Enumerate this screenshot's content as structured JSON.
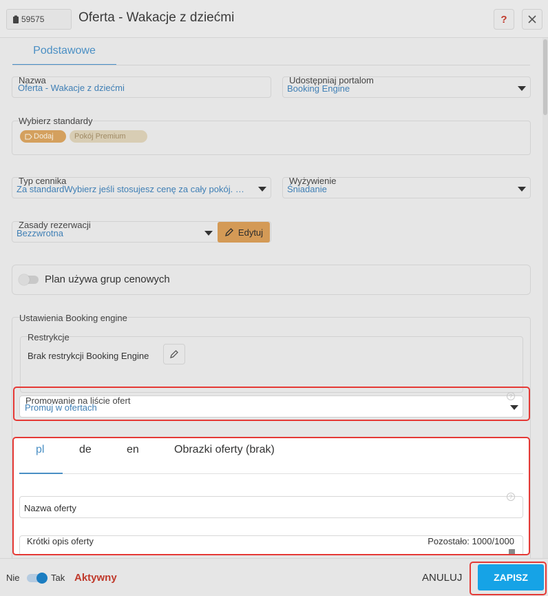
{
  "header": {
    "id": "59575",
    "title": "Oferta - Wakacje z dziećmi",
    "help_label": "?"
  },
  "tabs": {
    "main": "Podstawowe"
  },
  "fields": {
    "name": {
      "label": "Nazwa",
      "value": "Oferta - Wakacje z dziećmi"
    },
    "portals": {
      "label": "Udostępniaj portalom",
      "value": "Booking Engine"
    },
    "standards": {
      "label": "Wybierz standardy",
      "chips": [
        "Dodaj",
        "Pokój Premium"
      ]
    },
    "price_type": {
      "label": "Typ cennika",
      "value": "Za standardWybierz jeśli stosujesz cenę za cały pokój. Osob"
    },
    "meals": {
      "label": "Wyżywienie",
      "value": "Śniadanie"
    },
    "booking_rules": {
      "label": "Zasady rezerwacji",
      "value": "Bezzwrotna",
      "edit_label": "Edytuj"
    }
  },
  "price_groups": {
    "label": "Plan używa grup cenowych",
    "enabled": false
  },
  "booking_engine": {
    "section_label": "Ustawienia Booking engine",
    "restrictions": {
      "label": "Restrykcje",
      "text": "Brak restrykcji Booking Engine"
    },
    "promotion": {
      "label": "Promowanie na liście ofert",
      "value": "Promuj w ofertach"
    }
  },
  "lang_tabs": [
    "pl",
    "de",
    "en",
    "Obrazki oferty (brak)"
  ],
  "offer": {
    "name_placeholder": "Nazwa oferty",
    "short_desc_label": "Krótki opis oferty",
    "remaining": "Pozostało: 1000/1000"
  },
  "footer": {
    "no_label": "Nie",
    "yes_label": "Tak",
    "status": "Aktywny",
    "cancel_label": "ANULUJ",
    "save_label": "ZAPISZ"
  },
  "colors": {
    "accent": "#4a8fc4",
    "save": "#16a3e6",
    "status_active": "#c0392b",
    "highlight": "#e53935",
    "edit_button": "#d49a56"
  }
}
